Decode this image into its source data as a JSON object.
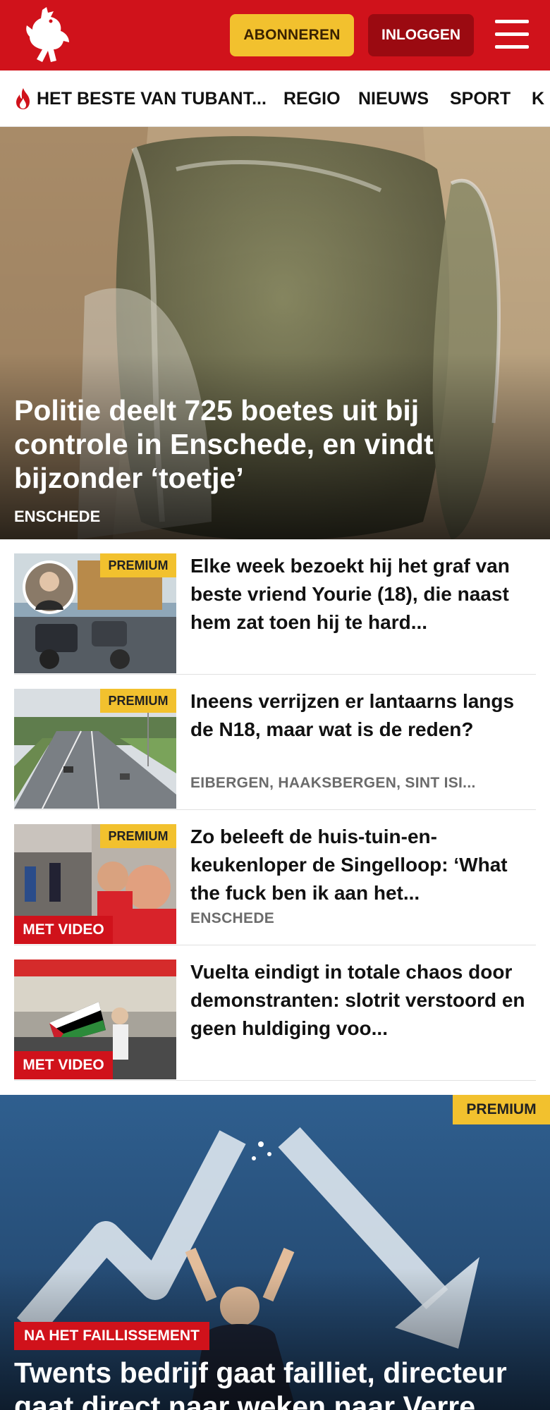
{
  "header": {
    "logo_icon": "tubantia-horse-logo-icon",
    "subscribe_label": "ABONNEREN",
    "login_label": "INLOGGEN",
    "menu_icon": "hamburger-menu-icon",
    "colors": {
      "brand": "#d0121b",
      "subscribe_bg": "#f2c12e",
      "login_bg": "#9b0a11"
    }
  },
  "nav": {
    "items": [
      {
        "label": "HET BESTE VAN TUBANT...",
        "icon": "flame-icon"
      },
      {
        "label": "REGIO"
      },
      {
        "label": "NIEUWS"
      },
      {
        "label": "SPORT"
      },
      {
        "label": "K"
      }
    ]
  },
  "hero": {
    "title": "Politie deelt 725 boetes uit bij controle in Enschede, en vindt bijzonder ‘toetje’",
    "category": "ENSCHEDE"
  },
  "articles": [
    {
      "title": "Elke week bezoekt hij het graf van beste vriend Yourie (18), die naast hem zat toen hij te hard...",
      "premium": "PREMIUM"
    },
    {
      "title": "Ineens verrijzen er lantaarns langs de N18, maar wat is de reden?",
      "premium": "PREMIUM",
      "category": "EIBERGEN, HAAKSBERGEN, SINT ISI..."
    },
    {
      "title": "Zo beleeft de huis-tuin-en-keukenloper de Singelloop: ‘What the fuck ben ik aan het...",
      "premium": "PREMIUM",
      "video": "MET VIDEO",
      "category": "ENSCHEDE"
    },
    {
      "title": "Vuelta eindigt in totale chaos door demonstranten: slotrit verstoord en geen huldiging voo...",
      "video": "MET VIDEO"
    }
  ],
  "hero2": {
    "premium": "PREMIUM",
    "tag": "NA HET FAILLISSEMENT",
    "title": "Twents bedrijf gaat failliet, directeur gaat direct naar weken naar Verre"
  }
}
